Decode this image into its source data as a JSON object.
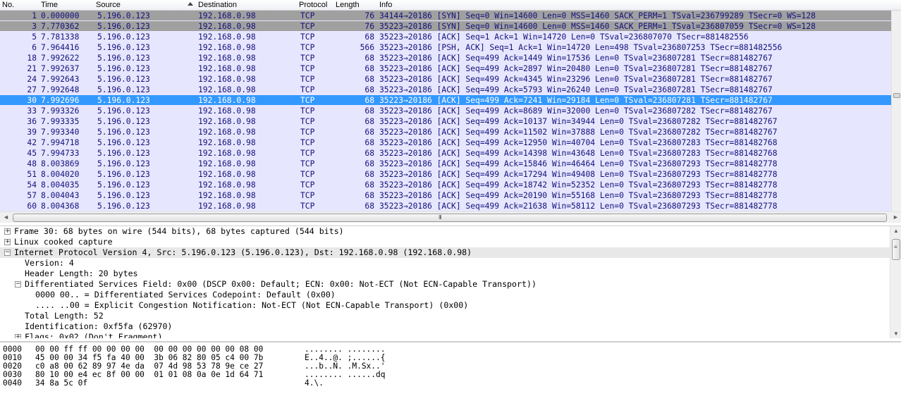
{
  "columns": {
    "no": "No.",
    "time": "Time",
    "source": "Source",
    "destination": "Destination",
    "protocol": "Protocol",
    "length": "Length",
    "info": "Info"
  },
  "packets": [
    {
      "no": "1",
      "time": "0.000000",
      "src": "5.196.0.123",
      "dst": "192.168.0.98",
      "proto": "TCP",
      "len": "76",
      "info": "34144→20186 [SYN] Seq=0 Win=14600 Len=0 MSS=1460 SACK_PERM=1 TSval=236799289 TSecr=0 WS=128",
      "style": "syn"
    },
    {
      "no": "3",
      "time": "7.770362",
      "src": "5.196.0.123",
      "dst": "192.168.0.98",
      "proto": "TCP",
      "len": "76",
      "info": "35223→20186 [SYN] Seq=0 Win=14600 Len=0 MSS=1460 SACK_PERM=1 TSval=236807059 TSecr=0 WS=128",
      "style": "syn"
    },
    {
      "no": "5",
      "time": "7.781338",
      "src": "5.196.0.123",
      "dst": "192.168.0.98",
      "proto": "TCP",
      "len": "68",
      "info": "35223→20186 [ACK] Seq=1 Ack=1 Win=14720 Len=0 TSval=236807070 TSecr=881482556",
      "style": "normal"
    },
    {
      "no": "6",
      "time": "7.964416",
      "src": "5.196.0.123",
      "dst": "192.168.0.98",
      "proto": "TCP",
      "len": "566",
      "info": "35223→20186 [PSH, ACK] Seq=1 Ack=1 Win=14720 Len=498 TSval=236807253 TSecr=881482556",
      "style": "normal"
    },
    {
      "no": "18",
      "time": "7.992622",
      "src": "5.196.0.123",
      "dst": "192.168.0.98",
      "proto": "TCP",
      "len": "68",
      "info": "35223→20186 [ACK] Seq=499 Ack=1449 Win=17536 Len=0 TSval=236807281 TSecr=881482767",
      "style": "normal"
    },
    {
      "no": "21",
      "time": "7.992637",
      "src": "5.196.0.123",
      "dst": "192.168.0.98",
      "proto": "TCP",
      "len": "68",
      "info": "35223→20186 [ACK] Seq=499 Ack=2897 Win=20480 Len=0 TSval=236807281 TSecr=881482767",
      "style": "normal"
    },
    {
      "no": "24",
      "time": "7.992643",
      "src": "5.196.0.123",
      "dst": "192.168.0.98",
      "proto": "TCP",
      "len": "68",
      "info": "35223→20186 [ACK] Seq=499 Ack=4345 Win=23296 Len=0 TSval=236807281 TSecr=881482767",
      "style": "normal"
    },
    {
      "no": "27",
      "time": "7.992648",
      "src": "5.196.0.123",
      "dst": "192.168.0.98",
      "proto": "TCP",
      "len": "68",
      "info": "35223→20186 [ACK] Seq=499 Ack=5793 Win=26240 Len=0 TSval=236807281 TSecr=881482767",
      "style": "normal"
    },
    {
      "no": "30",
      "time": "7.992696",
      "src": "5.196.0.123",
      "dst": "192.168.0.98",
      "proto": "TCP",
      "len": "68",
      "info": "35223→20186 [ACK] Seq=499 Ack=7241 Win=29184 Len=0 TSval=236807281 TSecr=881482767",
      "style": "sel"
    },
    {
      "no": "33",
      "time": "7.993326",
      "src": "5.196.0.123",
      "dst": "192.168.0.98",
      "proto": "TCP",
      "len": "68",
      "info": "35223→20186 [ACK] Seq=499 Ack=8689 Win=32000 Len=0 TSval=236807282 TSecr=881482767",
      "style": "normal"
    },
    {
      "no": "36",
      "time": "7.993335",
      "src": "5.196.0.123",
      "dst": "192.168.0.98",
      "proto": "TCP",
      "len": "68",
      "info": "35223→20186 [ACK] Seq=499 Ack=10137 Win=34944 Len=0 TSval=236807282 TSecr=881482767",
      "style": "normal"
    },
    {
      "no": "39",
      "time": "7.993340",
      "src": "5.196.0.123",
      "dst": "192.168.0.98",
      "proto": "TCP",
      "len": "68",
      "info": "35223→20186 [ACK] Seq=499 Ack=11502 Win=37888 Len=0 TSval=236807282 TSecr=881482767",
      "style": "normal"
    },
    {
      "no": "42",
      "time": "7.994718",
      "src": "5.196.0.123",
      "dst": "192.168.0.98",
      "proto": "TCP",
      "len": "68",
      "info": "35223→20186 [ACK] Seq=499 Ack=12950 Win=40704 Len=0 TSval=236807283 TSecr=881482768",
      "style": "normal"
    },
    {
      "no": "45",
      "time": "7.994733",
      "src": "5.196.0.123",
      "dst": "192.168.0.98",
      "proto": "TCP",
      "len": "68",
      "info": "35223→20186 [ACK] Seq=499 Ack=14398 Win=43648 Len=0 TSval=236807283 TSecr=881482768",
      "style": "normal"
    },
    {
      "no": "48",
      "time": "8.003869",
      "src": "5.196.0.123",
      "dst": "192.168.0.98",
      "proto": "TCP",
      "len": "68",
      "info": "35223→20186 [ACK] Seq=499 Ack=15846 Win=46464 Len=0 TSval=236807293 TSecr=881482778",
      "style": "normal"
    },
    {
      "no": "51",
      "time": "8.004020",
      "src": "5.196.0.123",
      "dst": "192.168.0.98",
      "proto": "TCP",
      "len": "68",
      "info": "35223→20186 [ACK] Seq=499 Ack=17294 Win=49408 Len=0 TSval=236807293 TSecr=881482778",
      "style": "normal"
    },
    {
      "no": "54",
      "time": "8.004035",
      "src": "5.196.0.123",
      "dst": "192.168.0.98",
      "proto": "TCP",
      "len": "68",
      "info": "35223→20186 [ACK] Seq=499 Ack=18742 Win=52352 Len=0 TSval=236807293 TSecr=881482778",
      "style": "normal"
    },
    {
      "no": "57",
      "time": "8.004043",
      "src": "5.196.0.123",
      "dst": "192.168.0.98",
      "proto": "TCP",
      "len": "68",
      "info": "35223→20186 [ACK] Seq=499 Ack=20190 Win=55168 Len=0 TSval=236807293 TSecr=881482778",
      "style": "normal"
    },
    {
      "no": "60",
      "time": "8.004368",
      "src": "5.196.0.123",
      "dst": "192.168.0.98",
      "proto": "TCP",
      "len": "68",
      "info": "35223→20186 [ACK] Seq=499 Ack=21638 Win=58112 Len=0 TSval=236807293 TSecr=881482778",
      "style": "normal"
    }
  ],
  "details": [
    {
      "level": 0,
      "expander": "plus",
      "text": "Frame 30: 68 bytes on wire (544 bits), 68 bytes captured (544 bits)"
    },
    {
      "level": 0,
      "expander": "plus",
      "text": "Linux cooked capture"
    },
    {
      "level": 0,
      "expander": "minus",
      "text": "Internet Protocol Version 4, Src: 5.196.0.123 (5.196.0.123), Dst: 192.168.0.98 (192.168.0.98)",
      "highlight": true
    },
    {
      "level": 1,
      "expander": "none",
      "text": "Version: 4"
    },
    {
      "level": 1,
      "expander": "none",
      "text": "Header Length: 20 bytes"
    },
    {
      "level": 1,
      "expander": "minus",
      "text": "Differentiated Services Field: 0x00 (DSCP 0x00: Default; ECN: 0x00: Not-ECT (Not ECN-Capable Transport))"
    },
    {
      "level": 2,
      "expander": "none",
      "text": "0000 00.. = Differentiated Services Codepoint: Default (0x00)"
    },
    {
      "level": 2,
      "expander": "none",
      "text": ".... ..00 = Explicit Congestion Notification: Not-ECT (Not ECN-Capable Transport) (0x00)"
    },
    {
      "level": 1,
      "expander": "none",
      "text": "Total Length: 52"
    },
    {
      "level": 1,
      "expander": "none",
      "text": "Identification: 0xf5fa (62970)"
    },
    {
      "level": 1,
      "expander": "plus",
      "text": "Flags: 0x02 (Don't Fragment)"
    }
  ],
  "hex": [
    {
      "offset": "0000",
      "bytes": "00 00 ff ff 00 00 00 00  00 00 00 00 00 00 08 00",
      "ascii": "........ ........"
    },
    {
      "offset": "0010",
      "bytes": "45 00 00 34 f5 fa 40 00  3b 06 82 80 05 c4 00 7b",
      "ascii": "E..4..@. ;......{"
    },
    {
      "offset": "0020",
      "bytes": "c0 a8 00 62 89 97 4e da  07 4d 98 53 78 9e ce 27",
      "ascii": "...b..N. .M.Sx..'"
    },
    {
      "offset": "0030",
      "bytes": "80 10 00 e4 ec 8f 00 00  01 01 08 0a 0e 1d 64 71",
      "ascii": "........ ......dq"
    },
    {
      "offset": "0040",
      "bytes": "34 8a 5c 0f",
      "ascii": "4.\\."
    }
  ],
  "scrollbar": {
    "grip": "III",
    "left_arrow": "◄",
    "right_arrow": "►",
    "up_arrow": "▲",
    "down_arrow": "▼"
  },
  "colors": {
    "row_bg": "#e7e6ff",
    "syn_bg": "#a0a0a0",
    "selected_bg": "#3399ff",
    "row_text": "#12127a"
  }
}
